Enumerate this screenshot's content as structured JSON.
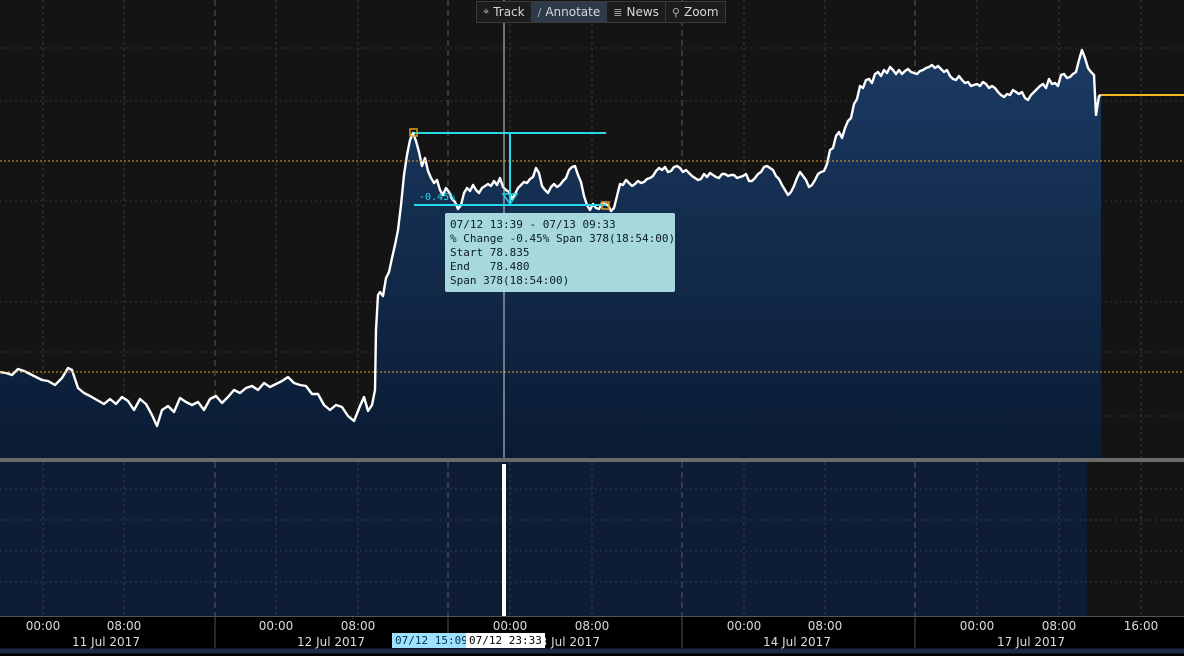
{
  "toolbar": {
    "items": [
      {
        "label": "Track",
        "icon": "crosshair-icon",
        "glyph": "⌖",
        "active": false
      },
      {
        "label": "Annotate",
        "icon": "pencil-icon",
        "glyph": "∕",
        "active": true
      },
      {
        "label": "News",
        "icon": "news-icon",
        "glyph": "≣",
        "active": false
      },
      {
        "label": "Zoom",
        "icon": "magnifier-icon",
        "glyph": "⚲",
        "active": false
      }
    ]
  },
  "annotation": {
    "pct_label": "-0.45%",
    "tooltip": {
      "line1": "07/12 13:39 - 07/13 09:33",
      "line2": "% Change -0.45% Span 378(18:54:00)",
      "line3": "Start 78.835",
      "line4": "End   78.480",
      "line5": "Span 378(18:54:00)"
    }
  },
  "cursor": {
    "label_a": "07/12 15:09",
    "label_b": "07/12 23:33"
  },
  "colors": {
    "line": "#ffffff",
    "fill_top": "#1b3a63",
    "fill_bottom": "#0c1f3a",
    "annotation": "#26d9e8",
    "reference": "#e0a020",
    "forward": "#f5b622"
  },
  "chart_data": {
    "type": "area",
    "x_unit": "time (hour of day)",
    "x_ticks": [
      "00:00",
      "08:00",
      "00:00",
      "08:00",
      "00:00",
      "08:00",
      "00:00",
      "08:00",
      "00:00",
      "08:00",
      "16:00"
    ],
    "day_labels": [
      "11 Jul 2017",
      "12 Jul 2017",
      "13 Jul 2017",
      "14 Jul 2017",
      "17 Jul 2017"
    ],
    "annotation_start": {
      "time": "07/12 13:39",
      "value": 78.835
    },
    "annotation_end": {
      "time": "07/13 09:33",
      "value": 78.48
    },
    "reference_lines": [
      "upper dotted",
      "lower dotted"
    ],
    "grid": true,
    "series": [
      {
        "values": [
          [
            0,
            372
          ],
          [
            6,
            373
          ],
          [
            12,
            375
          ],
          [
            18,
            369
          ],
          [
            24,
            371
          ],
          [
            30,
            374
          ],
          [
            36,
            377
          ],
          [
            42,
            380
          ],
          [
            48,
            381
          ],
          [
            55,
            385
          ],
          [
            62,
            378
          ],
          [
            68,
            368
          ],
          [
            72,
            370
          ],
          [
            78,
            388
          ],
          [
            84,
            393
          ],
          [
            90,
            396
          ],
          [
            97,
            400
          ],
          [
            104,
            404
          ],
          [
            110,
            399
          ],
          [
            116,
            404
          ],
          [
            122,
            397
          ],
          [
            128,
            401
          ],
          [
            134,
            410
          ],
          [
            140,
            399
          ],
          [
            146,
            404
          ],
          [
            152,
            415
          ],
          [
            157,
            426
          ],
          [
            162,
            410
          ],
          [
            168,
            406
          ],
          [
            174,
            412
          ],
          [
            180,
            398
          ],
          [
            186,
            402
          ],
          [
            192,
            405
          ],
          [
            198,
            402
          ],
          [
            204,
            410
          ],
          [
            210,
            399
          ],
          [
            216,
            396
          ],
          [
            222,
            403
          ],
          [
            228,
            397
          ],
          [
            234,
            390
          ],
          [
            240,
            393
          ],
          [
            246,
            388
          ],
          [
            252,
            386
          ],
          [
            258,
            390
          ],
          [
            264,
            383
          ],
          [
            270,
            387
          ],
          [
            276,
            384
          ],
          [
            282,
            381
          ],
          [
            288,
            377
          ],
          [
            294,
            383
          ],
          [
            300,
            385
          ],
          [
            306,
            386
          ],
          [
            312,
            394
          ],
          [
            318,
            394
          ],
          [
            324,
            405
          ],
          [
            330,
            410
          ],
          [
            336,
            405
          ],
          [
            342,
            407
          ],
          [
            348,
            416
          ],
          [
            354,
            421
          ],
          [
            360,
            406
          ],
          [
            364,
            397
          ],
          [
            368,
            411
          ],
          [
            372,
            405
          ],
          [
            375,
            390
          ],
          [
            376,
            330
          ],
          [
            378,
            295
          ],
          [
            380,
            292
          ],
          [
            383,
            296
          ],
          [
            386,
            278
          ],
          [
            389,
            272
          ],
          [
            392,
            258
          ],
          [
            395,
            245
          ],
          [
            398,
            230
          ],
          [
            401,
            205
          ],
          [
            404,
            175
          ],
          [
            407,
            155
          ],
          [
            410,
            140
          ],
          [
            413,
            133
          ],
          [
            416,
            141
          ],
          [
            419,
            152
          ],
          [
            422,
            166
          ],
          [
            425,
            158
          ],
          [
            428,
            171
          ],
          [
            431,
            178
          ],
          [
            434,
            183
          ],
          [
            437,
            180
          ],
          [
            440,
            190
          ],
          [
            443,
            195
          ],
          [
            446,
            188
          ],
          [
            449,
            192
          ],
          [
            452,
            199
          ],
          [
            455,
            202
          ],
          [
            458,
            209
          ],
          [
            461,
            205
          ],
          [
            464,
            193
          ],
          [
            467,
            188
          ],
          [
            470,
            191
          ],
          [
            473,
            185
          ],
          [
            476,
            190
          ],
          [
            479,
            193
          ],
          [
            482,
            188
          ],
          [
            485,
            186
          ],
          [
            488,
            184
          ],
          [
            491,
            186
          ],
          [
            494,
            181
          ],
          [
            497,
            185
          ],
          [
            500,
            178
          ],
          [
            503,
            187
          ],
          [
            506,
            190
          ],
          [
            509,
            192
          ],
          [
            512,
            199
          ],
          [
            515,
            194
          ],
          [
            518,
            188
          ],
          [
            521,
            185
          ],
          [
            524,
            182
          ],
          [
            527,
            183
          ],
          [
            530,
            179
          ],
          [
            533,
            177
          ],
          [
            536,
            168
          ],
          [
            539,
            173
          ],
          [
            542,
            186
          ],
          [
            545,
            190
          ],
          [
            548,
            193
          ],
          [
            551,
            187
          ],
          [
            554,
            184
          ],
          [
            557,
            187
          ],
          [
            560,
            185
          ],
          [
            563,
            181
          ],
          [
            566,
            178
          ],
          [
            569,
            170
          ],
          [
            572,
            167
          ],
          [
            575,
            166
          ],
          [
            578,
            175
          ],
          [
            581,
            182
          ],
          [
            584,
            196
          ],
          [
            587,
            205
          ],
          [
            590,
            210
          ],
          [
            593,
            204
          ],
          [
            596,
            208
          ],
          [
            599,
            209
          ],
          [
            602,
            203
          ],
          [
            605,
            204
          ],
          [
            608,
            205
          ],
          [
            611,
            211
          ],
          [
            614,
            208
          ],
          [
            617,
            196
          ],
          [
            620,
            184
          ],
          [
            623,
            185
          ],
          [
            626,
            180
          ],
          [
            629,
            183
          ],
          [
            632,
            186
          ],
          [
            635,
            184
          ],
          [
            638,
            181
          ],
          [
            641,
            183
          ],
          [
            644,
            182
          ],
          [
            647,
            179
          ],
          [
            650,
            178
          ],
          [
            653,
            176
          ],
          [
            656,
            171
          ],
          [
            659,
            168
          ],
          [
            662,
            170
          ],
          [
            665,
            167
          ],
          [
            668,
            172
          ],
          [
            671,
            171
          ],
          [
            674,
            167
          ],
          [
            677,
            166
          ],
          [
            680,
            168
          ],
          [
            683,
            172
          ],
          [
            686,
            170
          ],
          [
            689,
            173
          ],
          [
            692,
            176
          ],
          [
            695,
            178
          ],
          [
            698,
            180
          ],
          [
            701,
            179
          ],
          [
            704,
            174
          ],
          [
            707,
            177
          ],
          [
            710,
            173
          ],
          [
            713,
            175
          ],
          [
            716,
            177
          ],
          [
            719,
            178
          ],
          [
            722,
            174
          ],
          [
            725,
            174
          ],
          [
            728,
            176
          ],
          [
            731,
            175
          ],
          [
            734,
            175
          ],
          [
            737,
            178
          ],
          [
            740,
            177
          ],
          [
            743,
            176
          ],
          [
            746,
            174
          ],
          [
            749,
            181
          ],
          [
            752,
            181
          ],
          [
            755,
            178
          ],
          [
            758,
            174
          ],
          [
            761,
            172
          ],
          [
            764,
            167
          ],
          [
            767,
            166
          ],
          [
            770,
            168
          ],
          [
            773,
            170
          ],
          [
            776,
            176
          ],
          [
            779,
            179
          ],
          [
            782,
            185
          ],
          [
            785,
            190
          ],
          [
            788,
            195
          ],
          [
            791,
            192
          ],
          [
            794,
            186
          ],
          [
            797,
            178
          ],
          [
            800,
            172
          ],
          [
            803,
            176
          ],
          [
            806,
            180
          ],
          [
            809,
            187
          ],
          [
            812,
            185
          ],
          [
            815,
            180
          ],
          [
            818,
            174
          ],
          [
            821,
            172
          ],
          [
            824,
            171
          ],
          [
            827,
            164
          ],
          [
            830,
            150
          ],
          [
            833,
            148
          ],
          [
            836,
            136
          ],
          [
            839,
            132
          ],
          [
            842,
            138
          ],
          [
            845,
            128
          ],
          [
            848,
            121
          ],
          [
            851,
            118
          ],
          [
            854,
            104
          ],
          [
            857,
            99
          ],
          [
            860,
            86
          ],
          [
            863,
            88
          ],
          [
            866,
            80
          ],
          [
            869,
            79
          ],
          [
            872,
            83
          ],
          [
            875,
            74
          ],
          [
            878,
            72
          ],
          [
            881,
            76
          ],
          [
            884,
            70
          ],
          [
            887,
            73
          ],
          [
            890,
            67
          ],
          [
            893,
            70
          ],
          [
            896,
            74
          ],
          [
            899,
            70
          ],
          [
            902,
            74
          ],
          [
            905,
            71
          ],
          [
            908,
            69
          ],
          [
            911,
            72
          ],
          [
            914,
            73
          ],
          [
            917,
            74
          ],
          [
            920,
            71
          ],
          [
            923,
            70
          ],
          [
            926,
            68
          ],
          [
            929,
            67
          ],
          [
            932,
            65
          ],
          [
            935,
            68
          ],
          [
            938,
            66
          ],
          [
            941,
            69
          ],
          [
            944,
            72
          ],
          [
            947,
            70
          ],
          [
            950,
            76
          ],
          [
            953,
            79
          ],
          [
            956,
            80
          ],
          [
            959,
            76
          ],
          [
            962,
            80
          ],
          [
            965,
            83
          ],
          [
            968,
            82
          ],
          [
            971,
            86
          ],
          [
            974,
            85
          ],
          [
            977,
            84
          ],
          [
            980,
            86
          ],
          [
            983,
            82
          ],
          [
            986,
            84
          ],
          [
            989,
            88
          ],
          [
            992,
            86
          ],
          [
            995,
            88
          ],
          [
            998,
            92
          ],
          [
            1001,
            95
          ],
          [
            1004,
            97
          ],
          [
            1007,
            94
          ],
          [
            1010,
            95
          ],
          [
            1013,
            90
          ],
          [
            1016,
            92
          ],
          [
            1019,
            94
          ],
          [
            1022,
            92
          ],
          [
            1025,
            98
          ],
          [
            1028,
            100
          ],
          [
            1031,
            95
          ],
          [
            1034,
            92
          ],
          [
            1037,
            89
          ],
          [
            1040,
            86
          ],
          [
            1043,
            84
          ],
          [
            1046,
            88
          ],
          [
            1049,
            79
          ],
          [
            1052,
            84
          ],
          [
            1055,
            83
          ],
          [
            1058,
            86
          ],
          [
            1061,
            75
          ],
          [
            1064,
            74
          ],
          [
            1067,
            78
          ],
          [
            1070,
            77
          ],
          [
            1073,
            74
          ],
          [
            1076,
            72
          ],
          [
            1079,
            60
          ],
          [
            1082,
            50
          ],
          [
            1085,
            58
          ],
          [
            1088,
            68
          ],
          [
            1091,
            72
          ],
          [
            1094,
            75
          ],
          [
            1096,
            115
          ],
          [
            1099,
            96
          ],
          [
            1101,
            95
          ]
        ]
      }
    ]
  }
}
